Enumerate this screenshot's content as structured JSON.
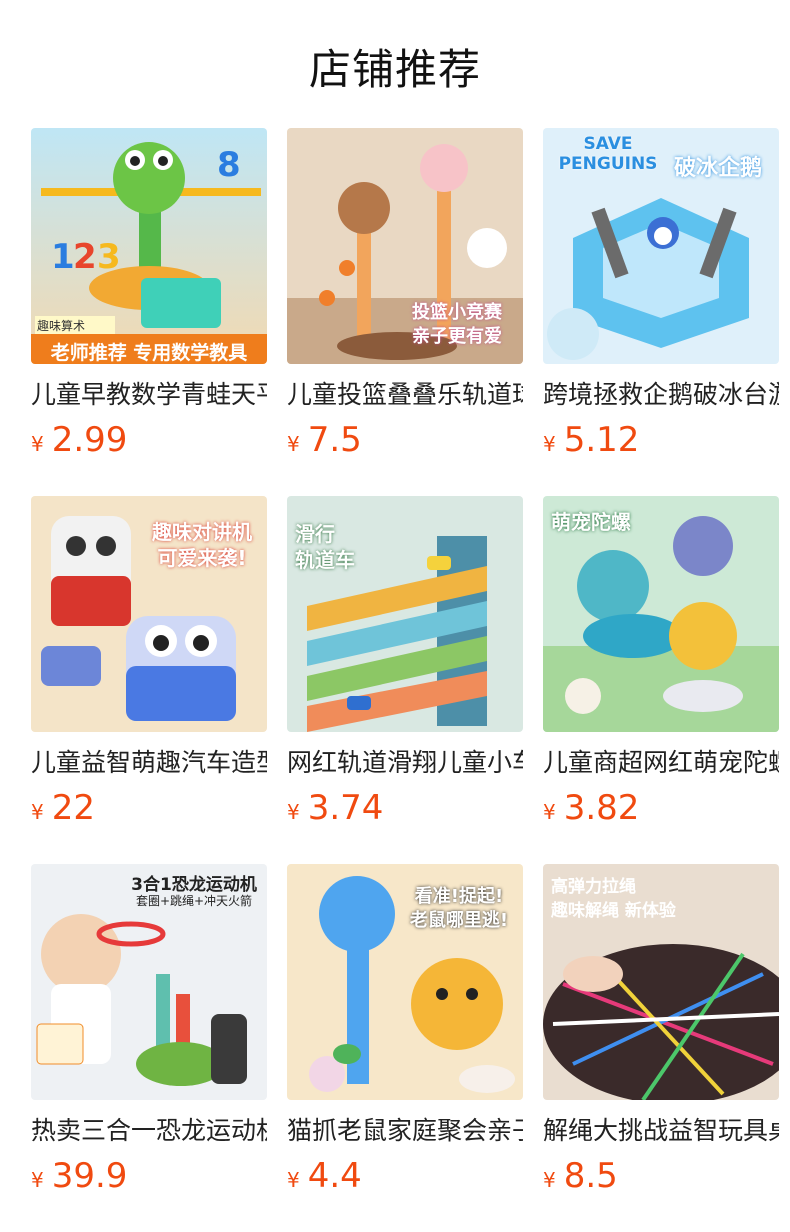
{
  "section_title": "店铺推荐",
  "products": [
    {
      "name": "儿童早教数学青蛙天平",
      "currency": "¥",
      "price": "2.99",
      "thumb_text": "趣味算术",
      "thumb_banner": "老师推荐 专用数学教具",
      "thumb_icon": "frog-balance-toy-image"
    },
    {
      "name": "儿童投篮叠叠乐轨道球",
      "currency": "¥",
      "price": "7.5",
      "thumb_text": "投篮小竞赛",
      "thumb_banner": "亲子更有爱",
      "thumb_icon": "basketball-track-toy-image"
    },
    {
      "name": "跨境拯救企鹅破冰台游戏",
      "currency": "¥",
      "price": "5.12",
      "thumb_text": "SAVE PENGUINS",
      "thumb_banner": "破冰企鹅",
      "thumb_icon": "penguin-ice-toy-image"
    },
    {
      "name": "儿童益智萌趣汽车造型对讲机",
      "currency": "¥",
      "price": "22",
      "thumb_text": "趣味对讲机",
      "thumb_banner": "可爱来袭!",
      "thumb_icon": "walkie-talkie-car-toy-image"
    },
    {
      "name": "网红轨道滑翔儿童小车",
      "currency": "¥",
      "price": "3.74",
      "thumb_text": "滑行",
      "thumb_banner": "轨道车",
      "thumb_icon": "slide-track-car-toy-image"
    },
    {
      "name": "儿童商超网红萌宠陀螺",
      "currency": "¥",
      "price": "3.82",
      "thumb_text": "萌宠陀螺",
      "thumb_banner": "",
      "thumb_icon": "spinning-top-toy-image"
    },
    {
      "name": "热卖三合一恐龙运动机",
      "currency": "¥",
      "price": "39.9",
      "thumb_text": "3合1恐龙运动机",
      "thumb_banner": "套圈+跳绳+冲天火箭",
      "thumb_icon": "dinosaur-sport-toy-image"
    },
    {
      "name": "猫抓老鼠家庭聚会亲子游戏",
      "currency": "¥",
      "price": "4.4",
      "thumb_text": "看准!捉起!",
      "thumb_banner": "老鼠哪里逃!",
      "thumb_icon": "cat-paw-mouse-game-image"
    },
    {
      "name": "解绳大挑战益智玩具桌游",
      "currency": "¥",
      "price": "8.5",
      "thumb_text": "高弹力拉绳",
      "thumb_banner": "趣味解绳 新体验",
      "thumb_icon": "rope-untangle-toy-image"
    }
  ],
  "colors": {
    "price": "#f04a10"
  }
}
